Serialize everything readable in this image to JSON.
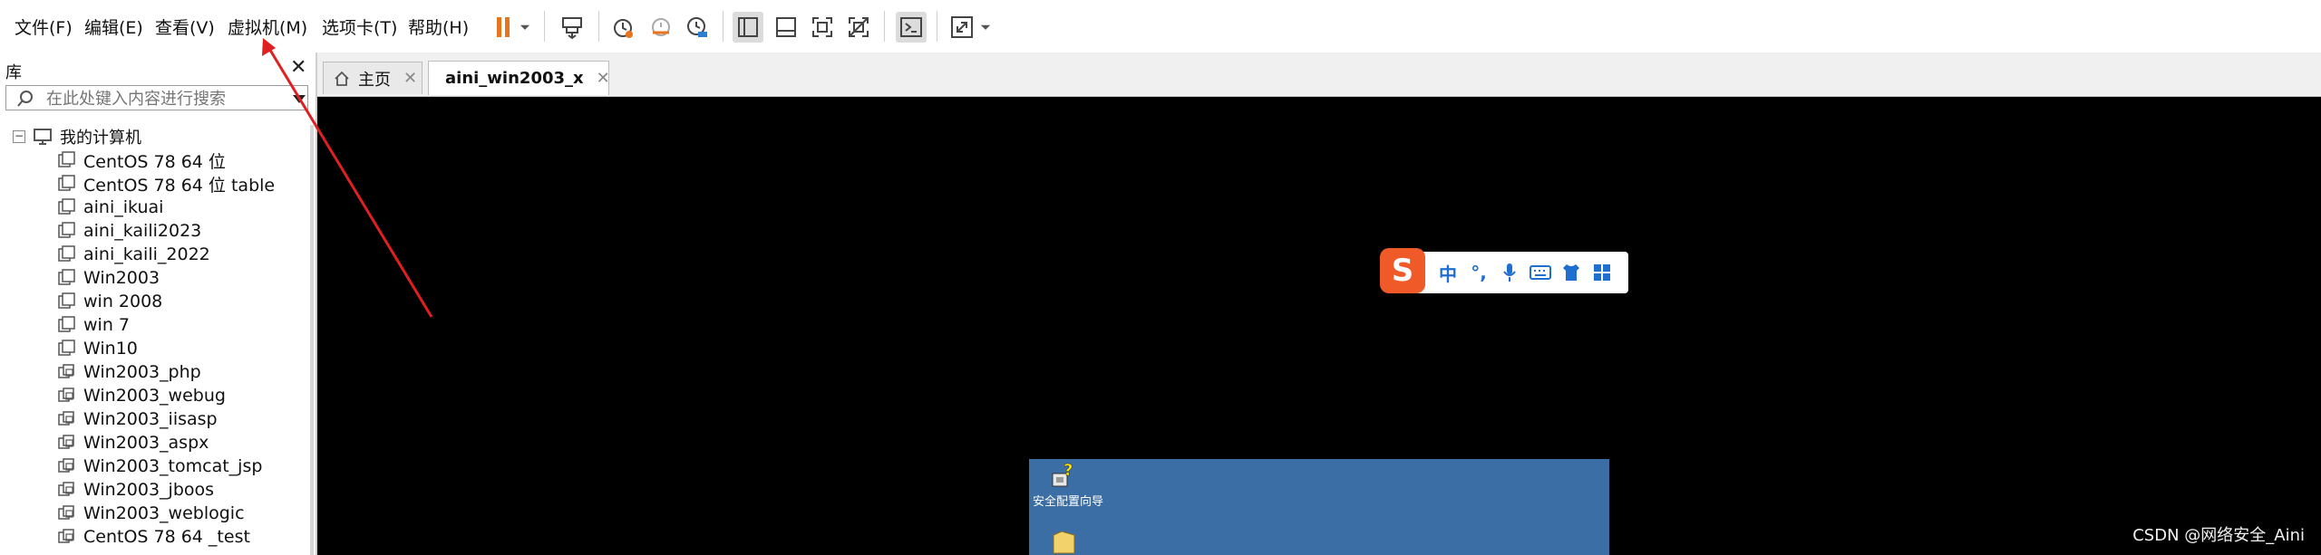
{
  "menu": {
    "file": "文件(F)",
    "edit": "编辑(E)",
    "view": "查看(V)",
    "vm": "虚拟机(M)",
    "tabs": "选项卡(T)",
    "help": "帮助(H)"
  },
  "toolbar": {
    "icons": [
      "pause-icon",
      "dropdown-icon",
      "send-keys-icon",
      "snapshot-icon",
      "revert-snapshot-icon",
      "snapshot-manager-icon",
      "library-view-icon",
      "thumbnail-view-icon",
      "fullscreen-icon",
      "unity-icon",
      "console-icon",
      "stretch-icon"
    ],
    "accent": "#e8741c"
  },
  "library": {
    "title": "库",
    "search_placeholder": "在此处键入内容进行搜索",
    "root": "我的计算机",
    "items": [
      {
        "label": "CentOS 78 64 位",
        "type": "vm"
      },
      {
        "label": "CentOS 78 64 位 table",
        "type": "vm"
      },
      {
        "label": "aini_ikuai",
        "type": "vm"
      },
      {
        "label": "aini_kaili2023",
        "type": "vm"
      },
      {
        "label": "aini_kaili_2022",
        "type": "vm"
      },
      {
        "label": "Win2003",
        "type": "vm"
      },
      {
        "label": "win 2008",
        "type": "vm"
      },
      {
        "label": "win 7",
        "type": "vm"
      },
      {
        "label": "Win10",
        "type": "vm"
      },
      {
        "label": "Win2003_php",
        "type": "clone"
      },
      {
        "label": "Win2003_webug",
        "type": "clone"
      },
      {
        "label": "Win2003_iisasp",
        "type": "clone"
      },
      {
        "label": "Win2003_aspx",
        "type": "clone"
      },
      {
        "label": "Win2003_tomcat_jsp",
        "type": "clone"
      },
      {
        "label": "Win2003_jboos",
        "type": "clone"
      },
      {
        "label": "Win2003_weblogic",
        "type": "clone"
      },
      {
        "label": "CentOS 78 64 _test",
        "type": "clone"
      }
    ]
  },
  "tabs": {
    "home": "主页",
    "vm": "aini_win2003_x"
  },
  "vm_screen": {
    "ime_logo": "S",
    "ime_mode": "中",
    "ime_punct": "°,",
    "desktop_icon_label": "安全配置向导",
    "desktop_color": "#3a6ea5"
  },
  "watermark": "CSDN @网络安全_Aini",
  "annotation": {
    "color": "#e02020"
  }
}
